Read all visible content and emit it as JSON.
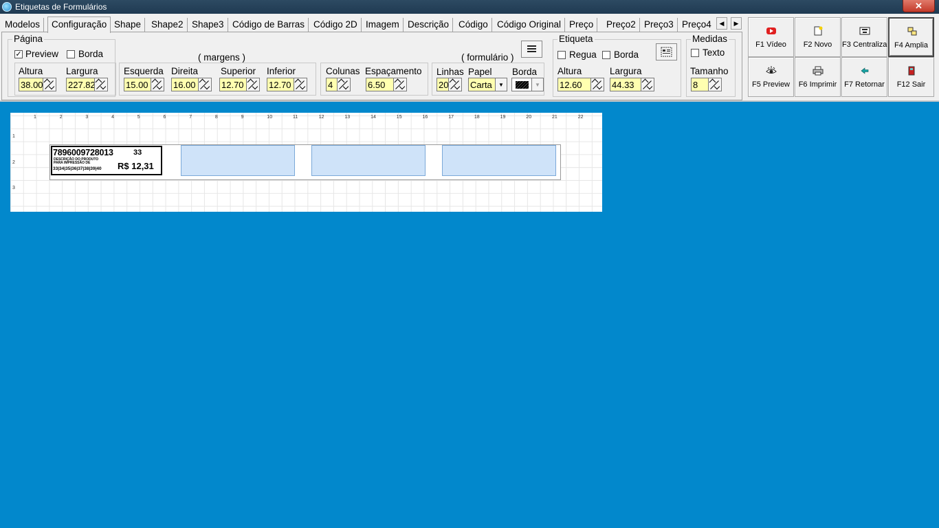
{
  "window": {
    "title": "Etiquetas de Formulários",
    "close": "✕"
  },
  "tabs": [
    "Modelos",
    "Configuração",
    "Shape",
    "Shape2",
    "Shape3",
    "Código de Barras",
    "Código 2D",
    "Imagem",
    "Descrição",
    "Código",
    "Código Original",
    "Preço",
    "Preço2",
    "Preço3",
    "Preço4"
  ],
  "active_tab": "Configuração",
  "pagina": {
    "legend": "Página",
    "preview_label": "Preview",
    "preview_checked": true,
    "borda_label": "Borda",
    "borda_checked": false,
    "altura_label": "Altura",
    "altura": "38.00",
    "largura_label": "Largura",
    "largura": "227.82"
  },
  "margens": {
    "caption": "( margens )",
    "esquerda_label": "Esquerda",
    "esquerda": "15.00",
    "direita_label": "Direita",
    "direita": "16.00",
    "superior_label": "Superior",
    "superior": "12.70",
    "inferior_label": "Inferior",
    "inferior": "12.70"
  },
  "formulario": {
    "caption": "( formulário )",
    "colunas_label": "Colunas",
    "colunas": "4",
    "espacamento_label": "Espaçamento",
    "espacamento": "6.50",
    "linhas_label": "Linhas",
    "linhas": "20",
    "papel_label": "Papel",
    "papel": "Carta",
    "borda_label": "Borda"
  },
  "etiqueta": {
    "legend": "Etiqueta",
    "regua_label": "Regua",
    "regua_checked": false,
    "borda_label": "Borda",
    "borda_checked": false,
    "altura_label": "Altura",
    "altura": "12.60",
    "largura_label": "Largura",
    "largura": "44.33"
  },
  "medidas": {
    "legend": "Medidas",
    "texto_label": "Texto",
    "texto_checked": false,
    "tamanho_label": "Tamanho",
    "tamanho": "8"
  },
  "function_buttons": [
    {
      "label": "F1 Vídeo",
      "icon": "video-icon"
    },
    {
      "label": "F2 Novo",
      "icon": "new-document-icon"
    },
    {
      "label": "F3 Centraliza",
      "icon": "center-icon"
    },
    {
      "label": "F4 Amplia",
      "icon": "zoom-icon"
    },
    {
      "label": "F5 Preview",
      "icon": "preview-eye-icon"
    },
    {
      "label": "F6 Imprimir",
      "icon": "printer-icon"
    },
    {
      "label": "F7 Retornar",
      "icon": "back-arrow-icon"
    },
    {
      "label": "F12 Sair",
      "icon": "exit-door-icon"
    }
  ],
  "preview": {
    "ruler_x": [
      "1",
      "2",
      "3",
      "4",
      "5",
      "6",
      "7",
      "8",
      "9",
      "10",
      "11",
      "12",
      "13",
      "14",
      "15",
      "16",
      "17",
      "18",
      "19",
      "20",
      "21",
      "22",
      "2"
    ],
    "ruler_y": [
      "1",
      "2",
      "3"
    ],
    "label": {
      "barcode": "7896009728013",
      "size": "33",
      "desc_line1": "DESCRIÇÃO DO PRODUTO",
      "desc_line2": "PARA IMPRESSÃO DE",
      "sizes": "33|34|35|36|37|38|39|40",
      "price": "R$ 12,31"
    }
  },
  "colors": {
    "background": "#0288cc",
    "field": "#ffffb0",
    "ghost_label": "#cfe3f9"
  }
}
